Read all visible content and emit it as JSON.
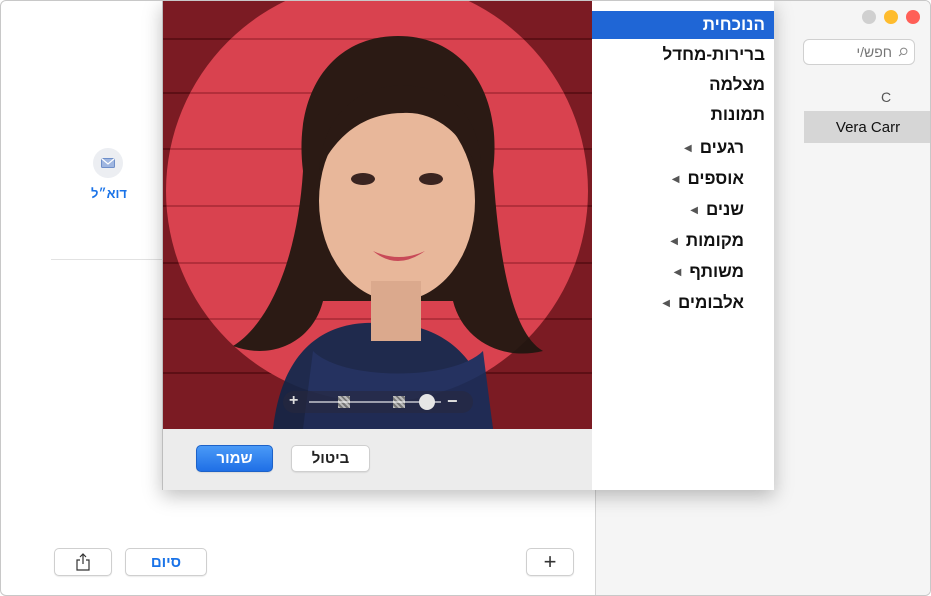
{
  "window": {
    "traffic_lights": {
      "close": "#ff5f57",
      "minimize": "#febc2e",
      "zoom": "#d0d0d0"
    }
  },
  "sidebar": {
    "search_placeholder": "חפש/י",
    "section_letter": "C",
    "contacts": [
      "Vera Carr"
    ]
  },
  "main": {
    "email_label": "דוא״ל",
    "done_label": "סיום",
    "add_label": "+"
  },
  "photo_menu": {
    "items": [
      {
        "label": "הנוכחית",
        "selected": true,
        "expandable": false
      },
      {
        "label": "ברירות-מחדל",
        "selected": false,
        "expandable": false
      },
      {
        "label": "מצלמה",
        "selected": false,
        "expandable": false
      },
      {
        "label": "תמונות",
        "selected": false,
        "expandable": false
      },
      {
        "label": "רגעים",
        "selected": false,
        "expandable": true
      },
      {
        "label": "אוספים",
        "selected": false,
        "expandable": true
      },
      {
        "label": "שנים",
        "selected": false,
        "expandable": true
      },
      {
        "label": "מקומות",
        "selected": false,
        "expandable": true
      },
      {
        "label": "משותף",
        "selected": false,
        "expandable": true
      },
      {
        "label": "אלבומים",
        "selected": false,
        "expandable": true
      }
    ]
  },
  "photo_editor": {
    "cancel_label": "ביטול",
    "save_label": "שמור",
    "zoom_minus": "−",
    "zoom_plus": "+",
    "zoom_level": 0.15,
    "accent": "#1f66d6"
  }
}
